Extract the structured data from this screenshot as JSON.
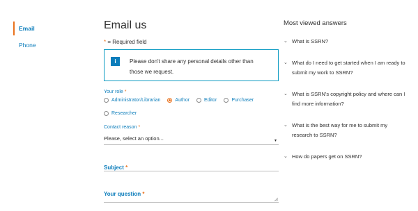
{
  "nav": {
    "items": [
      {
        "label": "Email",
        "active": true
      },
      {
        "label": "Phone",
        "active": false
      }
    ]
  },
  "form": {
    "title": "Email us",
    "required_note": "= Required field",
    "required_star": "*",
    "info_icon": "i",
    "info_message": "Please don't share any personal details other than those we request.",
    "role_label": "Your role",
    "roles": [
      {
        "label": "Administrator/Librarian",
        "checked": false
      },
      {
        "label": "Author",
        "checked": true
      },
      {
        "label": "Editor",
        "checked": false
      },
      {
        "label": "Purchaser",
        "checked": false
      },
      {
        "label": "Researcher",
        "checked": false
      }
    ],
    "contact_reason_label": "Contact reason",
    "contact_reason_value": "Please, select an option...",
    "subject_label": "Subject",
    "question_label": "Your question"
  },
  "faq": {
    "title": "Most viewed answers",
    "items": [
      "What is SSRN?",
      "What do I need to get started when I am ready to submit my work to SSRN?",
      "What is SSRN's copyright policy and where can I find more information?",
      "What is the best way for me to submit my research to SSRN?",
      "How do papers get on SSRN?"
    ]
  },
  "colors": {
    "accent_orange": "#e9711c",
    "link_blue": "#0c7dbb",
    "info_border": "#0c9bc2"
  }
}
